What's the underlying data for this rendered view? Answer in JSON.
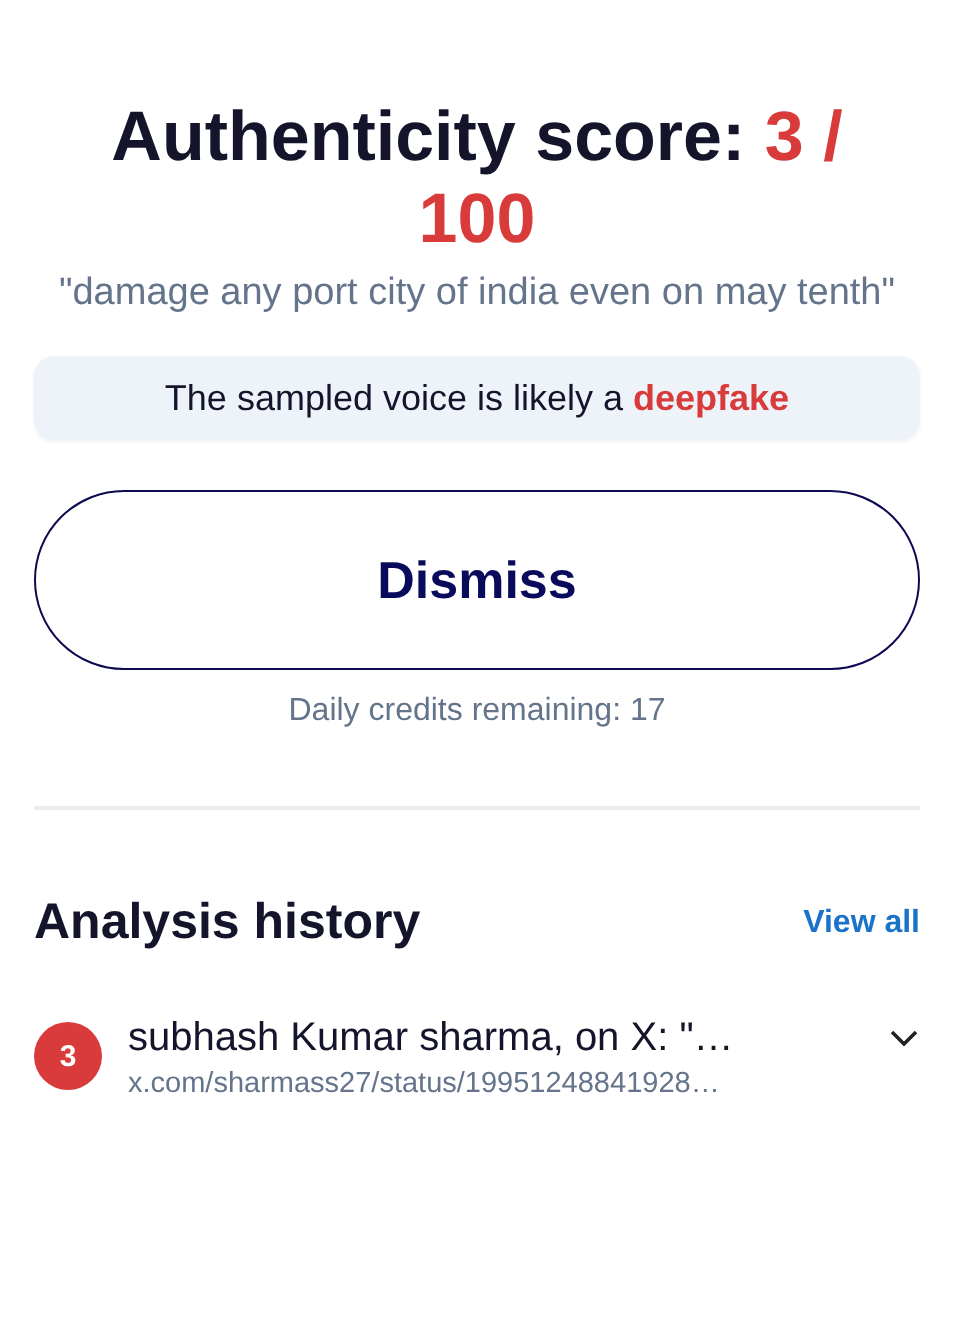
{
  "score": {
    "label": "Authenticity score:",
    "value": "3 / 100"
  },
  "quote": "\"damage any port city of india even on may tenth\"",
  "verdict": "The sampled voice is likely a **deepfake**",
  "dismiss_button": "Dismiss",
  "credits": "Daily credits remaining: 17",
  "history": {
    "title": "Analysis history",
    "view_all": "View all",
    "items": [
      {
        "score": "3",
        "color": "#d93a3a",
        "title": "subhash Kumar sharma, on X: \"…",
        "url": "x.com/sharmass27/status/19951248841928…",
        "expanded": false
      }
    ]
  }
}
